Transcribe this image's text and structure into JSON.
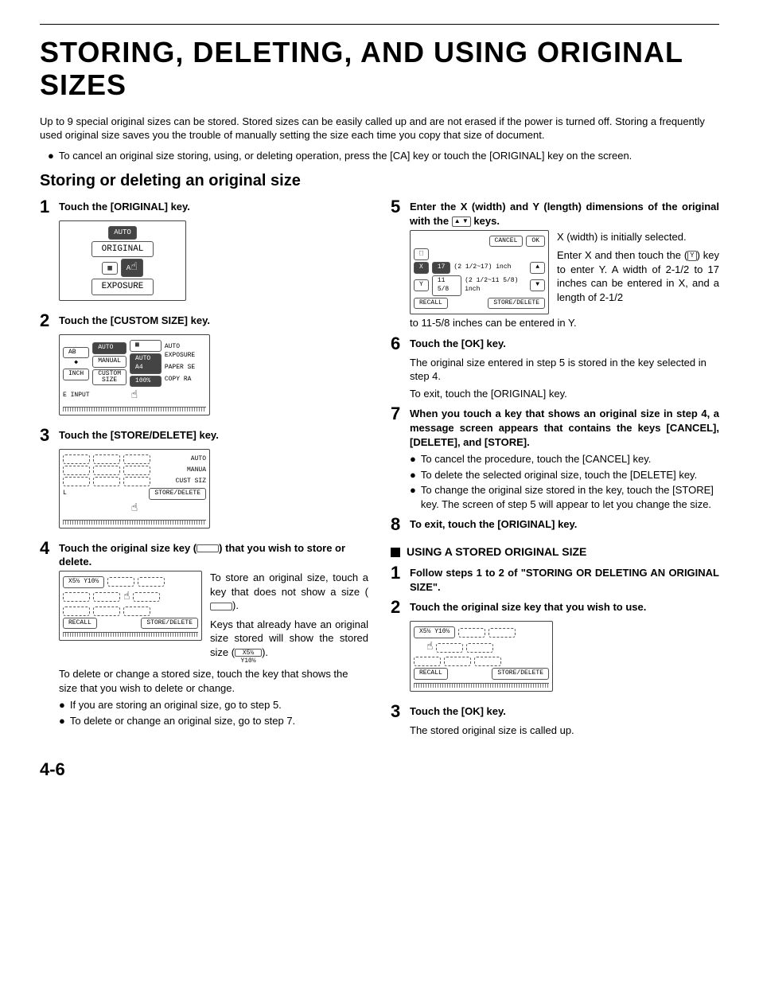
{
  "title": "STORING, DELETING, AND USING ORIGINAL SIZES",
  "intro": "Up to 9 special original sizes can be stored. Stored sizes can be easily called up and are not erased if the power is turned off. Storing a frequently used original size saves you the trouble of manually setting the size each time you copy that size of document.",
  "intro_bullet": "To cancel an original size storing, using, or deleting operation, press the [CA] key or touch the [ORIGINAL] key on the screen.",
  "section1": "Storing or deleting an original size",
  "step1_title": "Touch the [ORIGINAL] key.",
  "step2_title": "Touch the [CUSTOM SIZE] key.",
  "step3_title": "Touch the [STORE/DELETE] key.",
  "step4_title_a": "Touch the original size key (",
  "step4_title_b": ") that you wish to store or delete.",
  "step4_p1": "To store an original size, touch a key that does not show a size (",
  "step4_p1b": ").",
  "step4_p2": "Keys that already have an original size stored will show the stored size (",
  "step4_p2b": ").",
  "step4_p3": "To delete or change a stored size, touch the key that shows the size that you wish to delete or change.",
  "step4_b1": "If you are storing an original size, go to step 5.",
  "step4_b2": "To delete or change an original size, go to step 7.",
  "step5_title_a": "Enter the X (width) and Y (length) dimensions of the original with the ",
  "step5_title_b": " keys.",
  "step5_p1": "X (width) is initially selected.",
  "step5_p2a": "Enter X and then touch the (",
  "step5_p2b": ") key to enter Y. A width of 2-1/2 to 17 inches can be entered in X, and a length of 2-1/2",
  "step5_p3": "to 11-5/8 inches can be entered in Y.",
  "step6_title": "Touch the [OK] key.",
  "step6_p1": "The original size entered in step 5 is stored in the key selected in step 4.",
  "step6_p2": "To exit, touch the [ORIGINAL] key.",
  "step7_title": "When you touch a key that shows an original size in step 4, a message screen appears that contains the keys [CANCEL], [DELETE], and [STORE].",
  "step7_b1": "To cancel the procedure, touch the [CANCEL] key.",
  "step7_b2": "To delete the selected original size, touch the [DELETE] key.",
  "step7_b3": "To change the original size stored in the key, touch the [STORE] key. The screen of step 5 will appear to let you change the size.",
  "step8_title": "To exit, touch the [ORIGINAL] key.",
  "section2": "USING A STORED ORIGINAL SIZE",
  "u_step1_title": "Follow steps 1 to 2 of \"STORING OR DELETING AN ORIGINAL SIZE\".",
  "u_step2_title": "Touch the original size key that you wish to use.",
  "u_step3_title": "Touch the [OK] key.",
  "u_step3_p": "The stored original size is called up.",
  "page_num": "4-6",
  "screens": {
    "s1_auto": "AUTO",
    "s1_original": "ORIGINAL",
    "s1_auto2": "AUTO",
    "s1_exposure": "EXPOSURE",
    "s2_ab": "AB",
    "s2_inch": "INCH",
    "s2_auto": "AUTO",
    "s2_manual": "MANUAL",
    "s2_custom": "CUSTOM SIZE",
    "s2_exposure": "AUTO EXPOSURE",
    "s2_a4": "AUTO   A4",
    "s2_paper": "PAPER SE",
    "s2_copy": "100% COPY RA",
    "s2_input": "E INPUT",
    "s3_store": "STORE/DELETE",
    "s3_auto": "AUTO",
    "s3_manu": "MANUA",
    "s3_cust": "CUST SIZ",
    "s4_x5y10": "X5½ Y10½",
    "s4_recall": "RECALL",
    "s4_store": "STORE/DELETE",
    "s5_cancel": "CANCEL",
    "s5_ok": "OK",
    "s5_x": "X",
    "s5_y": "Y",
    "s5_xval": "17",
    "s5_xrange": "(2 1/2~17) inch",
    "s5_yval": "11 5/8",
    "s5_yrange": "(2 1/2~11 5/8) inch",
    "s5_recall": "RECALL",
    "s5_store": "STORE/DELETE",
    "y_key": "Y",
    "inline_x5y10": "X5½ Y10½"
  }
}
